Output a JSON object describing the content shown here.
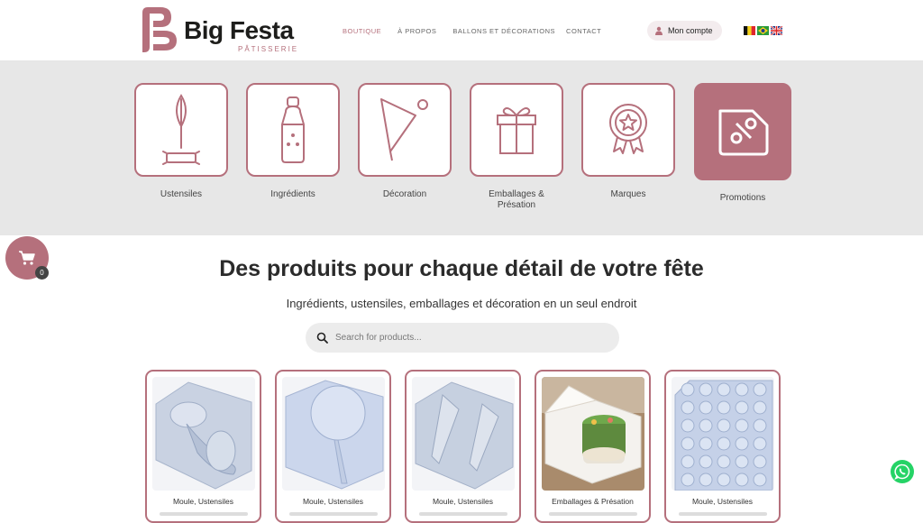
{
  "header": {
    "logo_text": "Big Festa",
    "logo_sub": "PÂTISSERIE",
    "nav": [
      "BOUTIQUE",
      "À PROPOS",
      "BALLONS ET DÉCORATIONS",
      "CONTACT"
    ],
    "account_label": "Mon compte",
    "flags": [
      "flag-belgium",
      "flag-brazil",
      "flag-uk"
    ]
  },
  "categories": [
    {
      "label": "Ustensiles",
      "icon": "whisk-icon"
    },
    {
      "label": "Ingrédients",
      "icon": "bottle-icon"
    },
    {
      "label": "Décoration",
      "icon": "piping-bag-icon"
    },
    {
      "label": "Emballages & Présation",
      "icon": "gift-box-icon"
    },
    {
      "label": "Marques",
      "icon": "badge-icon"
    },
    {
      "label": "Promotions",
      "icon": "discount-tag-icon"
    }
  ],
  "cart": {
    "count": "0"
  },
  "hero": {
    "title": "Des produits pour chaque détail de votre fête",
    "subtitle": "Ingrédients, ustensiles, emballages et décoration en un seul endroit"
  },
  "search": {
    "placeholder": "Search for products..."
  },
  "products": [
    {
      "category": "Moule, Ustensiles"
    },
    {
      "category": "Moule, Ustensiles"
    },
    {
      "category": "Moule, Ustensiles"
    },
    {
      "category": "Emballages & Présation"
    },
    {
      "category": "Moule, Ustensiles"
    }
  ],
  "colors": {
    "accent": "#b5707c",
    "band": "#e7e7e7",
    "whatsapp": "#25d366"
  }
}
